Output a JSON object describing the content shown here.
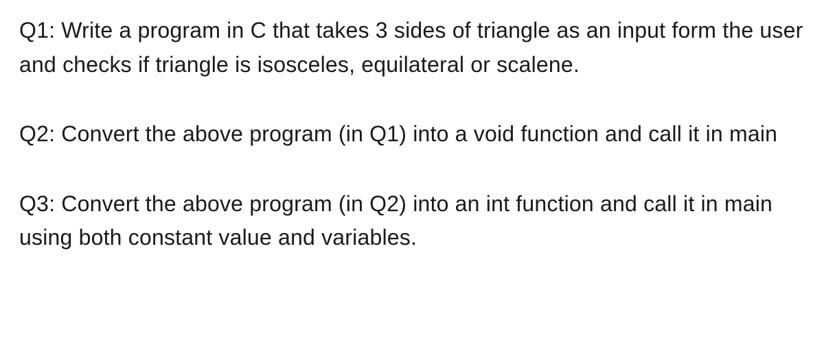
{
  "questions": [
    {
      "text": "Q1: Write a program in C that takes 3 sides of triangle as an input form the user and checks if triangle is isosceles, equilateral or scalene."
    },
    {
      "text": "Q2: Convert the above program (in Q1) into a void function and call it in main"
    },
    {
      "text": "Q3: Convert the above program (in Q2) into an int function and call it in main using both constant value and variables."
    }
  ]
}
